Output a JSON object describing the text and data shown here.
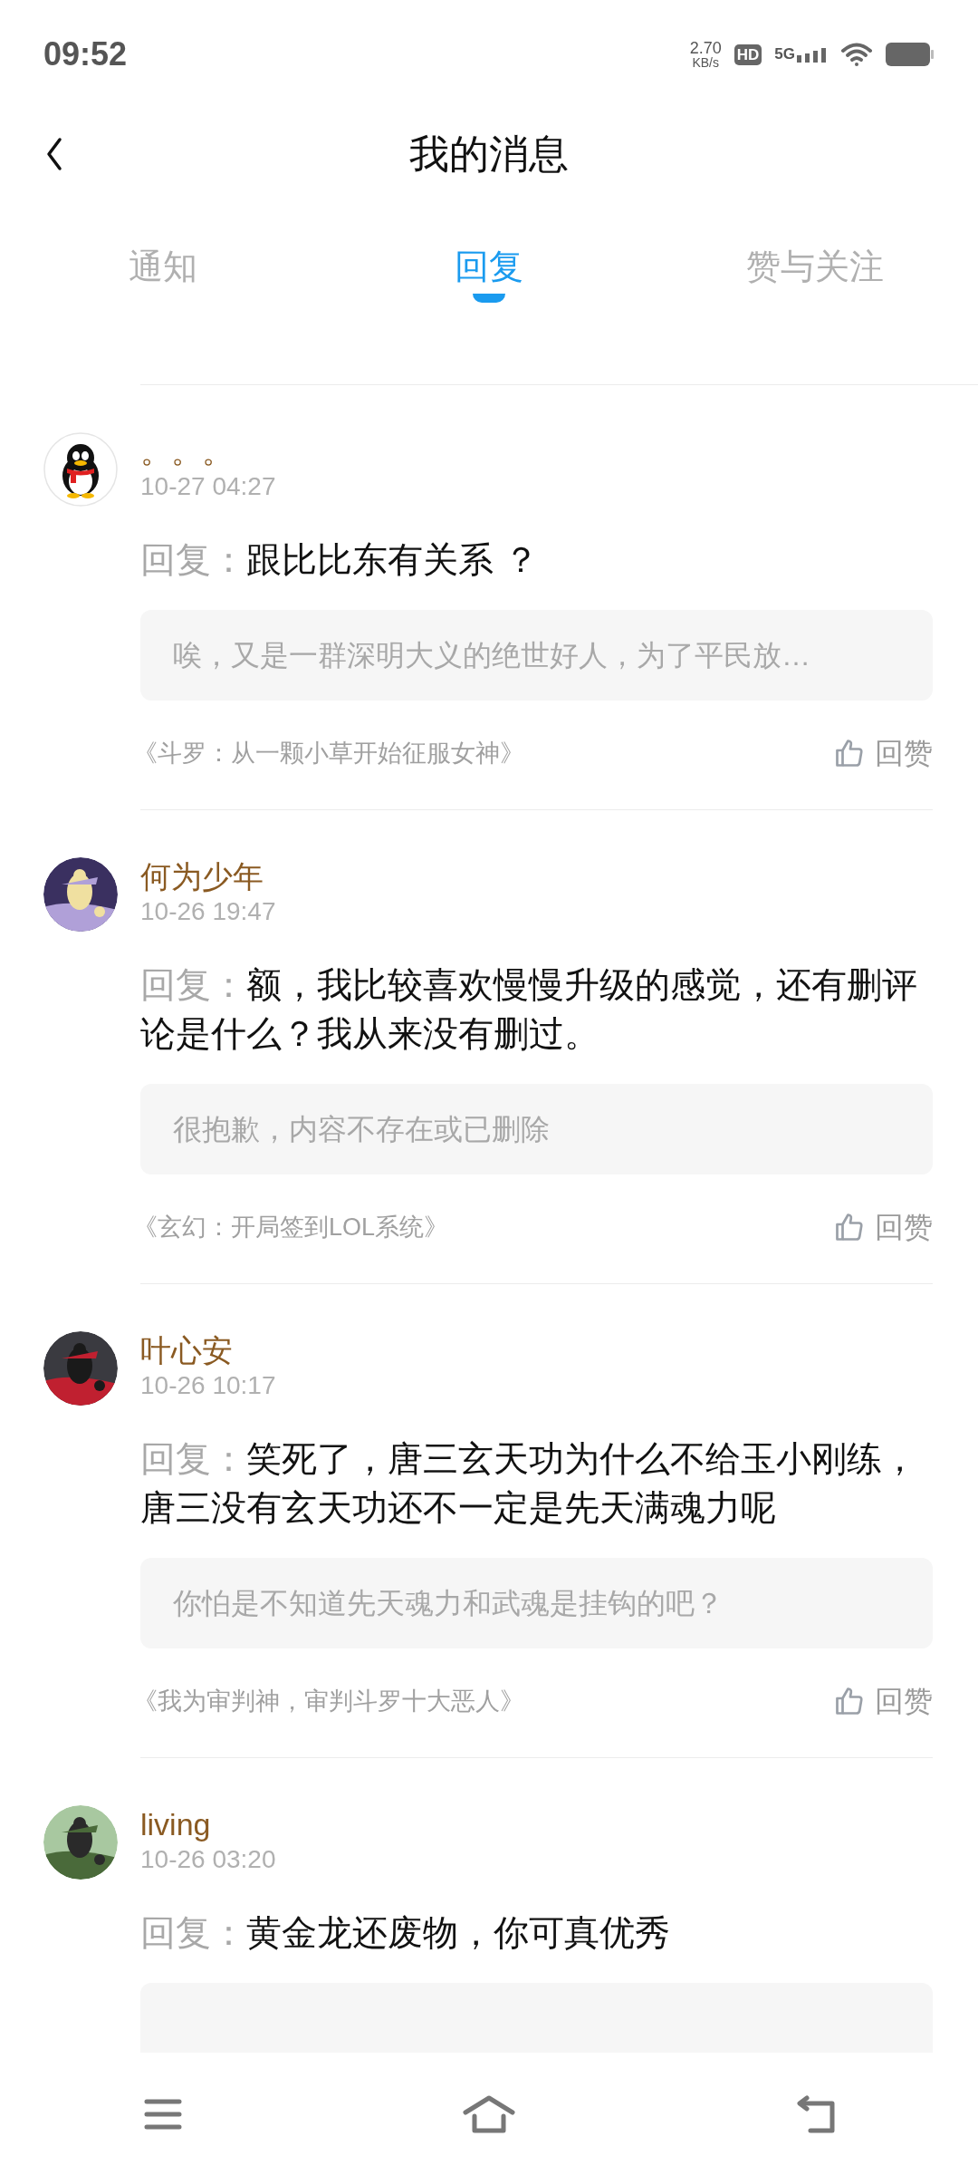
{
  "status_bar": {
    "time": "09:52",
    "speed_value": "2.70",
    "speed_unit": "KB/s",
    "hd": "HD",
    "network": "5G"
  },
  "header": {
    "title": "我的消息"
  },
  "tabs": [
    {
      "label": "通知",
      "selected": false
    },
    {
      "label": "回复",
      "selected": true
    },
    {
      "label": "赞与关注",
      "selected": false
    }
  ],
  "messages": [
    {
      "name": "。。。",
      "time": "10-27 04:27",
      "kind": "penguin",
      "reply_label": "回复：",
      "reply": "跟比比东有关系 ？",
      "quote": "唉，又是一群深明大义的绝世好人，为了平民放…",
      "source": "《斗罗：从一颗小草开始征服女神》",
      "like": "回赞"
    },
    {
      "name": "何为少年",
      "time": "10-26 19:47",
      "kind": "picture",
      "reply_label": "回复：",
      "reply": "额，我比较喜欢慢慢升级的感觉，还有删评论是什么？我从来没有删过。",
      "quote": "很抱歉，内容不存在或已删除",
      "source": "《玄幻：开局签到LOL系统》",
      "like": "回赞"
    },
    {
      "name": "叶心安",
      "time": "10-26 10:17",
      "kind": "picture",
      "reply_label": "回复：",
      "reply": "笑死了，唐三玄天功为什么不给玉小刚练，唐三没有玄天功还不一定是先天满魂力呢",
      "quote": "你怕是不知道先天魂力和武魂是挂钩的吧？",
      "source": "《我为审判神，审判斗罗十大恶人》",
      "like": "回赞"
    },
    {
      "name": "living",
      "time": "10-26 03:20",
      "kind": "picture",
      "reply_label": "回复：",
      "reply": "黄金龙还废物，你可真优秀"
    }
  ]
}
